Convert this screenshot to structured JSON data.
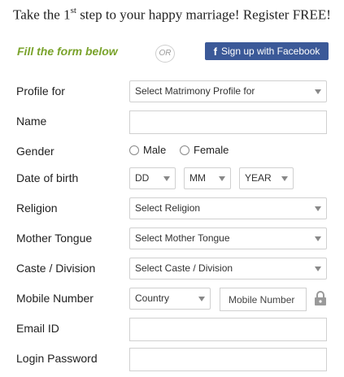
{
  "header": {
    "headline_pre": "Take the 1",
    "headline_sup": "st",
    "headline_post": " step to your happy marriage! Register FREE!"
  },
  "intro": {
    "fill_text": "Fill the form below",
    "or_text": "OR",
    "facebook_label": "Sign up with Facebook",
    "facebook_icon": "f"
  },
  "form": {
    "profile_for": {
      "label": "Profile for",
      "select": "Select Matrimony Profile for"
    },
    "name": {
      "label": "Name",
      "value": ""
    },
    "gender": {
      "label": "Gender",
      "options": [
        "Male",
        "Female"
      ]
    },
    "dob": {
      "label": "Date of birth",
      "day": "DD",
      "month": "MM",
      "year": "YEAR"
    },
    "religion": {
      "label": "Religion",
      "select": "Select Religion"
    },
    "mother_tongue": {
      "label": "Mother Tongue",
      "select": "Select Mother Tongue"
    },
    "caste": {
      "label": "Caste / Division",
      "select": "Select Caste / Division"
    },
    "mobile": {
      "label": "Mobile Number",
      "country": "Country",
      "placeholder": "Mobile Number"
    },
    "email": {
      "label": "Email ID",
      "value": ""
    },
    "password": {
      "label": "Login Password",
      "value": ""
    }
  },
  "colors": {
    "facebook_blue": "#3b5998",
    "fill_green": "#7aa32c"
  }
}
